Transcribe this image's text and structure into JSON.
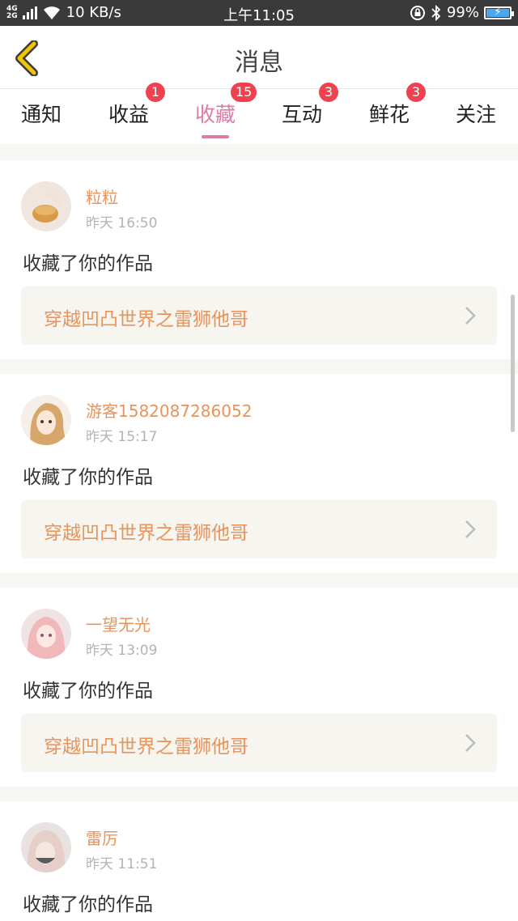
{
  "status_bar": {
    "network_top": "4G",
    "network_bottom": "2G",
    "speed": "10 KB/s",
    "time": "上午11:05",
    "battery_pct": "99%",
    "battery_level": 0.99
  },
  "header": {
    "title": "消息",
    "back_icon": "chevron-left-icon",
    "back_color": "#f2c500"
  },
  "tabs": [
    {
      "label": "通知",
      "badge": ""
    },
    {
      "label": "收益",
      "badge": "1"
    },
    {
      "label": "收藏",
      "badge": "15",
      "active": true
    },
    {
      "label": "互动",
      "badge": "3"
    },
    {
      "label": "鲜花",
      "badge": "3"
    },
    {
      "label": "关注",
      "badge": ""
    }
  ],
  "colors": {
    "accent": "#e07aa6",
    "badge": "#f0414f",
    "name": "#e9935b",
    "link_bg": "#f6f5f0"
  },
  "messages": [
    {
      "user": "粒粒",
      "time": "昨天 16:50",
      "action": "收藏了你的作品",
      "work": "穿越凹凸世界之雷狮他哥"
    },
    {
      "user": "游客1582087286052",
      "time": "昨天 15:17",
      "action": "收藏了你的作品",
      "work": "穿越凹凸世界之雷狮他哥"
    },
    {
      "user": "一望无光",
      "time": "昨天 13:09",
      "action": "收藏了你的作品",
      "work": "穿越凹凸世界之雷狮他哥"
    },
    {
      "user": "雷厉",
      "time": "昨天 11:51",
      "action": "收藏了你的作品",
      "work": ""
    }
  ]
}
